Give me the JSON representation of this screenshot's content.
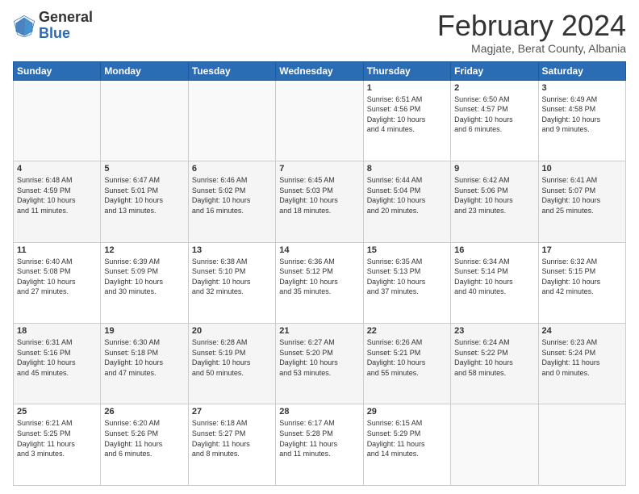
{
  "logo": {
    "general": "General",
    "blue": "Blue"
  },
  "title": "February 2024",
  "subtitle": "Magjate, Berat County, Albania",
  "days_header": [
    "Sunday",
    "Monday",
    "Tuesday",
    "Wednesday",
    "Thursday",
    "Friday",
    "Saturday"
  ],
  "weeks": [
    [
      {
        "day": "",
        "info": ""
      },
      {
        "day": "",
        "info": ""
      },
      {
        "day": "",
        "info": ""
      },
      {
        "day": "",
        "info": ""
      },
      {
        "day": "1",
        "info": "Sunrise: 6:51 AM\nSunset: 4:56 PM\nDaylight: 10 hours\nand 4 minutes."
      },
      {
        "day": "2",
        "info": "Sunrise: 6:50 AM\nSunset: 4:57 PM\nDaylight: 10 hours\nand 6 minutes."
      },
      {
        "day": "3",
        "info": "Sunrise: 6:49 AM\nSunset: 4:58 PM\nDaylight: 10 hours\nand 9 minutes."
      }
    ],
    [
      {
        "day": "4",
        "info": "Sunrise: 6:48 AM\nSunset: 4:59 PM\nDaylight: 10 hours\nand 11 minutes."
      },
      {
        "day": "5",
        "info": "Sunrise: 6:47 AM\nSunset: 5:01 PM\nDaylight: 10 hours\nand 13 minutes."
      },
      {
        "day": "6",
        "info": "Sunrise: 6:46 AM\nSunset: 5:02 PM\nDaylight: 10 hours\nand 16 minutes."
      },
      {
        "day": "7",
        "info": "Sunrise: 6:45 AM\nSunset: 5:03 PM\nDaylight: 10 hours\nand 18 minutes."
      },
      {
        "day": "8",
        "info": "Sunrise: 6:44 AM\nSunset: 5:04 PM\nDaylight: 10 hours\nand 20 minutes."
      },
      {
        "day": "9",
        "info": "Sunrise: 6:42 AM\nSunset: 5:06 PM\nDaylight: 10 hours\nand 23 minutes."
      },
      {
        "day": "10",
        "info": "Sunrise: 6:41 AM\nSunset: 5:07 PM\nDaylight: 10 hours\nand 25 minutes."
      }
    ],
    [
      {
        "day": "11",
        "info": "Sunrise: 6:40 AM\nSunset: 5:08 PM\nDaylight: 10 hours\nand 27 minutes."
      },
      {
        "day": "12",
        "info": "Sunrise: 6:39 AM\nSunset: 5:09 PM\nDaylight: 10 hours\nand 30 minutes."
      },
      {
        "day": "13",
        "info": "Sunrise: 6:38 AM\nSunset: 5:10 PM\nDaylight: 10 hours\nand 32 minutes."
      },
      {
        "day": "14",
        "info": "Sunrise: 6:36 AM\nSunset: 5:12 PM\nDaylight: 10 hours\nand 35 minutes."
      },
      {
        "day": "15",
        "info": "Sunrise: 6:35 AM\nSunset: 5:13 PM\nDaylight: 10 hours\nand 37 minutes."
      },
      {
        "day": "16",
        "info": "Sunrise: 6:34 AM\nSunset: 5:14 PM\nDaylight: 10 hours\nand 40 minutes."
      },
      {
        "day": "17",
        "info": "Sunrise: 6:32 AM\nSunset: 5:15 PM\nDaylight: 10 hours\nand 42 minutes."
      }
    ],
    [
      {
        "day": "18",
        "info": "Sunrise: 6:31 AM\nSunset: 5:16 PM\nDaylight: 10 hours\nand 45 minutes."
      },
      {
        "day": "19",
        "info": "Sunrise: 6:30 AM\nSunset: 5:18 PM\nDaylight: 10 hours\nand 47 minutes."
      },
      {
        "day": "20",
        "info": "Sunrise: 6:28 AM\nSunset: 5:19 PM\nDaylight: 10 hours\nand 50 minutes."
      },
      {
        "day": "21",
        "info": "Sunrise: 6:27 AM\nSunset: 5:20 PM\nDaylight: 10 hours\nand 53 minutes."
      },
      {
        "day": "22",
        "info": "Sunrise: 6:26 AM\nSunset: 5:21 PM\nDaylight: 10 hours\nand 55 minutes."
      },
      {
        "day": "23",
        "info": "Sunrise: 6:24 AM\nSunset: 5:22 PM\nDaylight: 10 hours\nand 58 minutes."
      },
      {
        "day": "24",
        "info": "Sunrise: 6:23 AM\nSunset: 5:24 PM\nDaylight: 11 hours\nand 0 minutes."
      }
    ],
    [
      {
        "day": "25",
        "info": "Sunrise: 6:21 AM\nSunset: 5:25 PM\nDaylight: 11 hours\nand 3 minutes."
      },
      {
        "day": "26",
        "info": "Sunrise: 6:20 AM\nSunset: 5:26 PM\nDaylight: 11 hours\nand 6 minutes."
      },
      {
        "day": "27",
        "info": "Sunrise: 6:18 AM\nSunset: 5:27 PM\nDaylight: 11 hours\nand 8 minutes."
      },
      {
        "day": "28",
        "info": "Sunrise: 6:17 AM\nSunset: 5:28 PM\nDaylight: 11 hours\nand 11 minutes."
      },
      {
        "day": "29",
        "info": "Sunrise: 6:15 AM\nSunset: 5:29 PM\nDaylight: 11 hours\nand 14 minutes."
      },
      {
        "day": "",
        "info": ""
      },
      {
        "day": "",
        "info": ""
      }
    ]
  ]
}
